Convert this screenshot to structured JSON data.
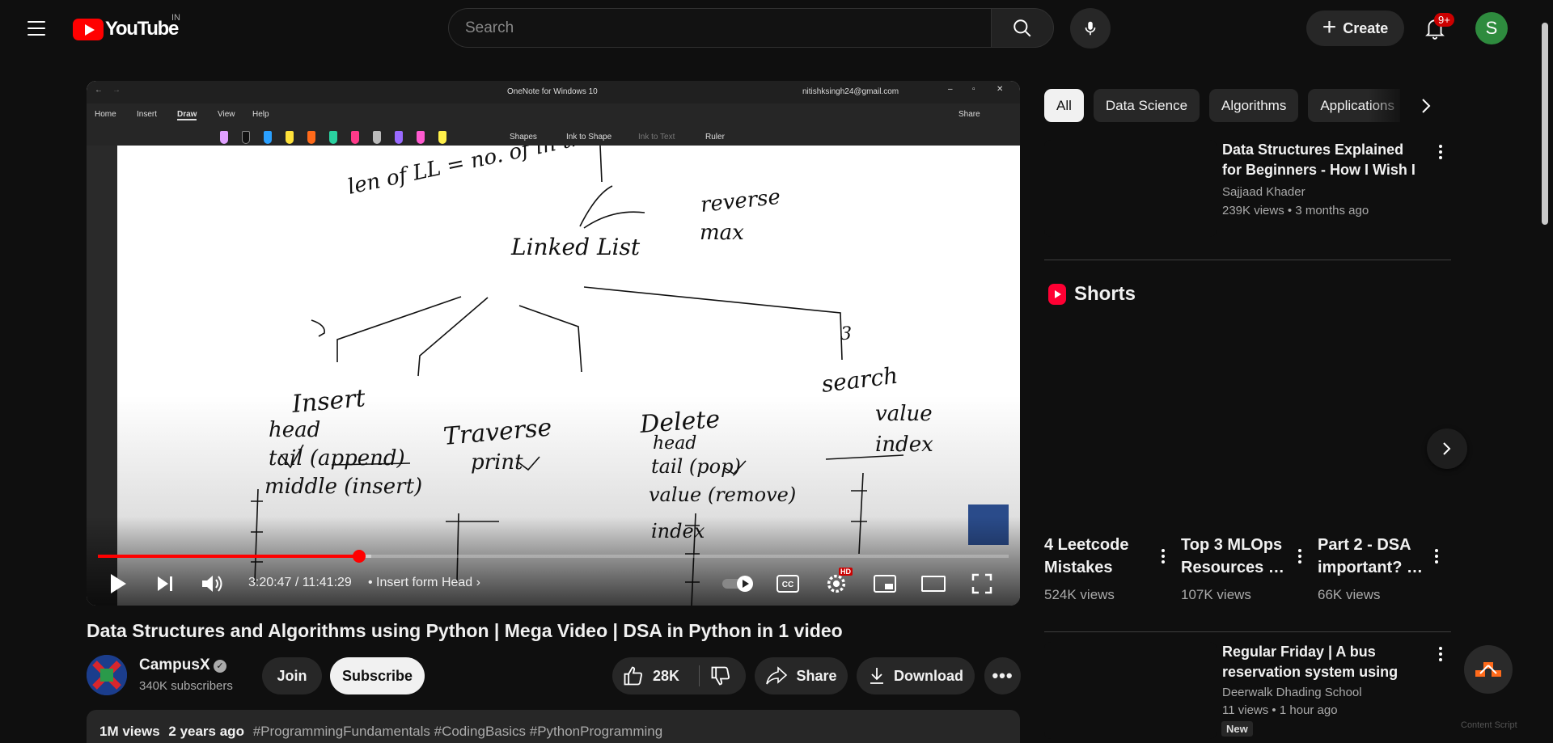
{
  "header": {
    "logo_text": "YouTube",
    "region": "IN",
    "search_placeholder": "Search",
    "create_label": "Create",
    "notification_count": "9+",
    "avatar_letter": "S"
  },
  "player": {
    "onenote_title": "OneNote for Windows 10",
    "onenote_email": "nitishksingh24@gmail.com",
    "ribbon_tabs": [
      "Home",
      "Insert",
      "Draw",
      "View",
      "Help"
    ],
    "ribbon_tools": [
      "Shapes",
      "Ink to Shape",
      "Ink to Text",
      "Ruler"
    ],
    "share_label": "Share",
    "ink_labels": {
      "top_left": "len of LL = no. of in the",
      "reverse": "reverse",
      "max": "max",
      "center": "Linked List",
      "insert": "Insert",
      "traverse": "Traverse",
      "delete": "Delete",
      "search": "search",
      "search_count": "3",
      "insert_items": [
        "head",
        "tail (append)",
        "middle (insert)"
      ],
      "traverse_items": [
        "print"
      ],
      "delete_items": [
        "head",
        "tail (pop)",
        "value (remove)",
        "index"
      ],
      "search_items": [
        "value",
        "index"
      ]
    },
    "progress_played": 0.287,
    "progress_loaded": 0.3,
    "time_current": "3:20:47",
    "time_total": "11:41:29",
    "time_display": "3:20:47 / 11:41:29",
    "chapter": "Insert form Head",
    "hd_badge": "HD",
    "cc_label": "CC"
  },
  "video": {
    "title": "Data Structures and Algorithms using Python | Mega Video | DSA in Python in 1 video",
    "channel": "CampusX",
    "subscribers": "340K subscribers",
    "join_label": "Join",
    "subscribe_label": "Subscribe",
    "likes": "28K",
    "share_label": "Share",
    "download_label": "Download",
    "views": "1M views",
    "age": "2 years ago",
    "hashtags": "#ProgrammingFundamentals #CodingBasics #PythonProgramming"
  },
  "chips": [
    "All",
    "Data Science",
    "Algorithms",
    "Applications"
  ],
  "recommendations": [
    {
      "title": "Data Structures Explained for Beginners - How I Wish I was…",
      "channel": "Sajjaad Khader",
      "views": "239K views",
      "age": "3 months ago"
    },
    {
      "title": "Regular Friday | A bus reservation system using C…",
      "channel": "Deerwalk Dhading School",
      "views": "11 views",
      "age": "1 hour ago",
      "badge": "New"
    }
  ],
  "shorts": {
    "heading": "Shorts",
    "items": [
      {
        "title": "4 Leetcode Mistakes",
        "views": "524K views"
      },
      {
        "title": "Top 3 MLOps Resources …",
        "views": "107K views"
      },
      {
        "title": "Part 2 - DSA important? …",
        "views": "66K views"
      }
    ]
  },
  "corner_text": "Content Script",
  "colors": {
    "background": "#0f0f0f",
    "accent_red": "#ff0000",
    "chip_bg": "#272727",
    "avatar_green": "#2e8b3e"
  }
}
